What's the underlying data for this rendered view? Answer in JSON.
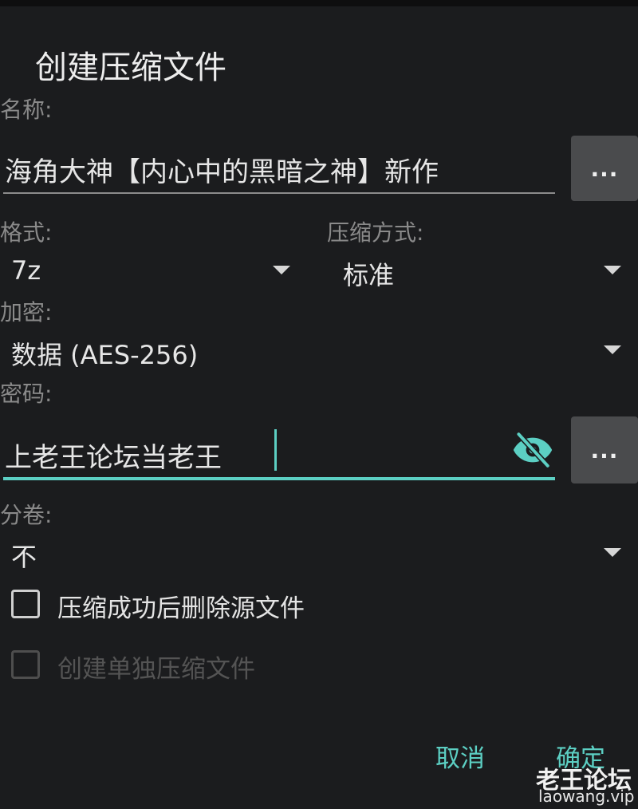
{
  "dialog": {
    "title": "创建压缩文件",
    "name": {
      "label": "名称:",
      "value": "海角大神【内心中的黑暗之神】新作",
      "browse_label": "..."
    },
    "format": {
      "label": "格式:",
      "value": "7z"
    },
    "compression_method": {
      "label": "压缩方式:",
      "value": "标准"
    },
    "encryption": {
      "label": "加密:",
      "value": "数据 (AES-256)"
    },
    "password": {
      "label": "密码:",
      "value": "上老王论坛当老王",
      "browse_label": "..."
    },
    "split_volume": {
      "label": "分卷:",
      "value": "不"
    },
    "options": [
      {
        "label": "压缩成功后删除源文件",
        "checked": false,
        "enabled": true
      },
      {
        "label": "创建单独压缩文件",
        "checked": false,
        "enabled": false
      }
    ],
    "actions": {
      "cancel": "取消",
      "confirm": "确定"
    }
  },
  "watermark": {
    "logo_text": "老王论坛",
    "url": "laowang.vip"
  },
  "colors": {
    "background": "#1b1c1e",
    "accent": "#5ccfc3",
    "button_gray": "#4a4b4d",
    "label_gray": "#8a8a8a"
  },
  "icons": {
    "password_toggle": "eye-off-icon",
    "dropdown": "caret-down-icon"
  }
}
